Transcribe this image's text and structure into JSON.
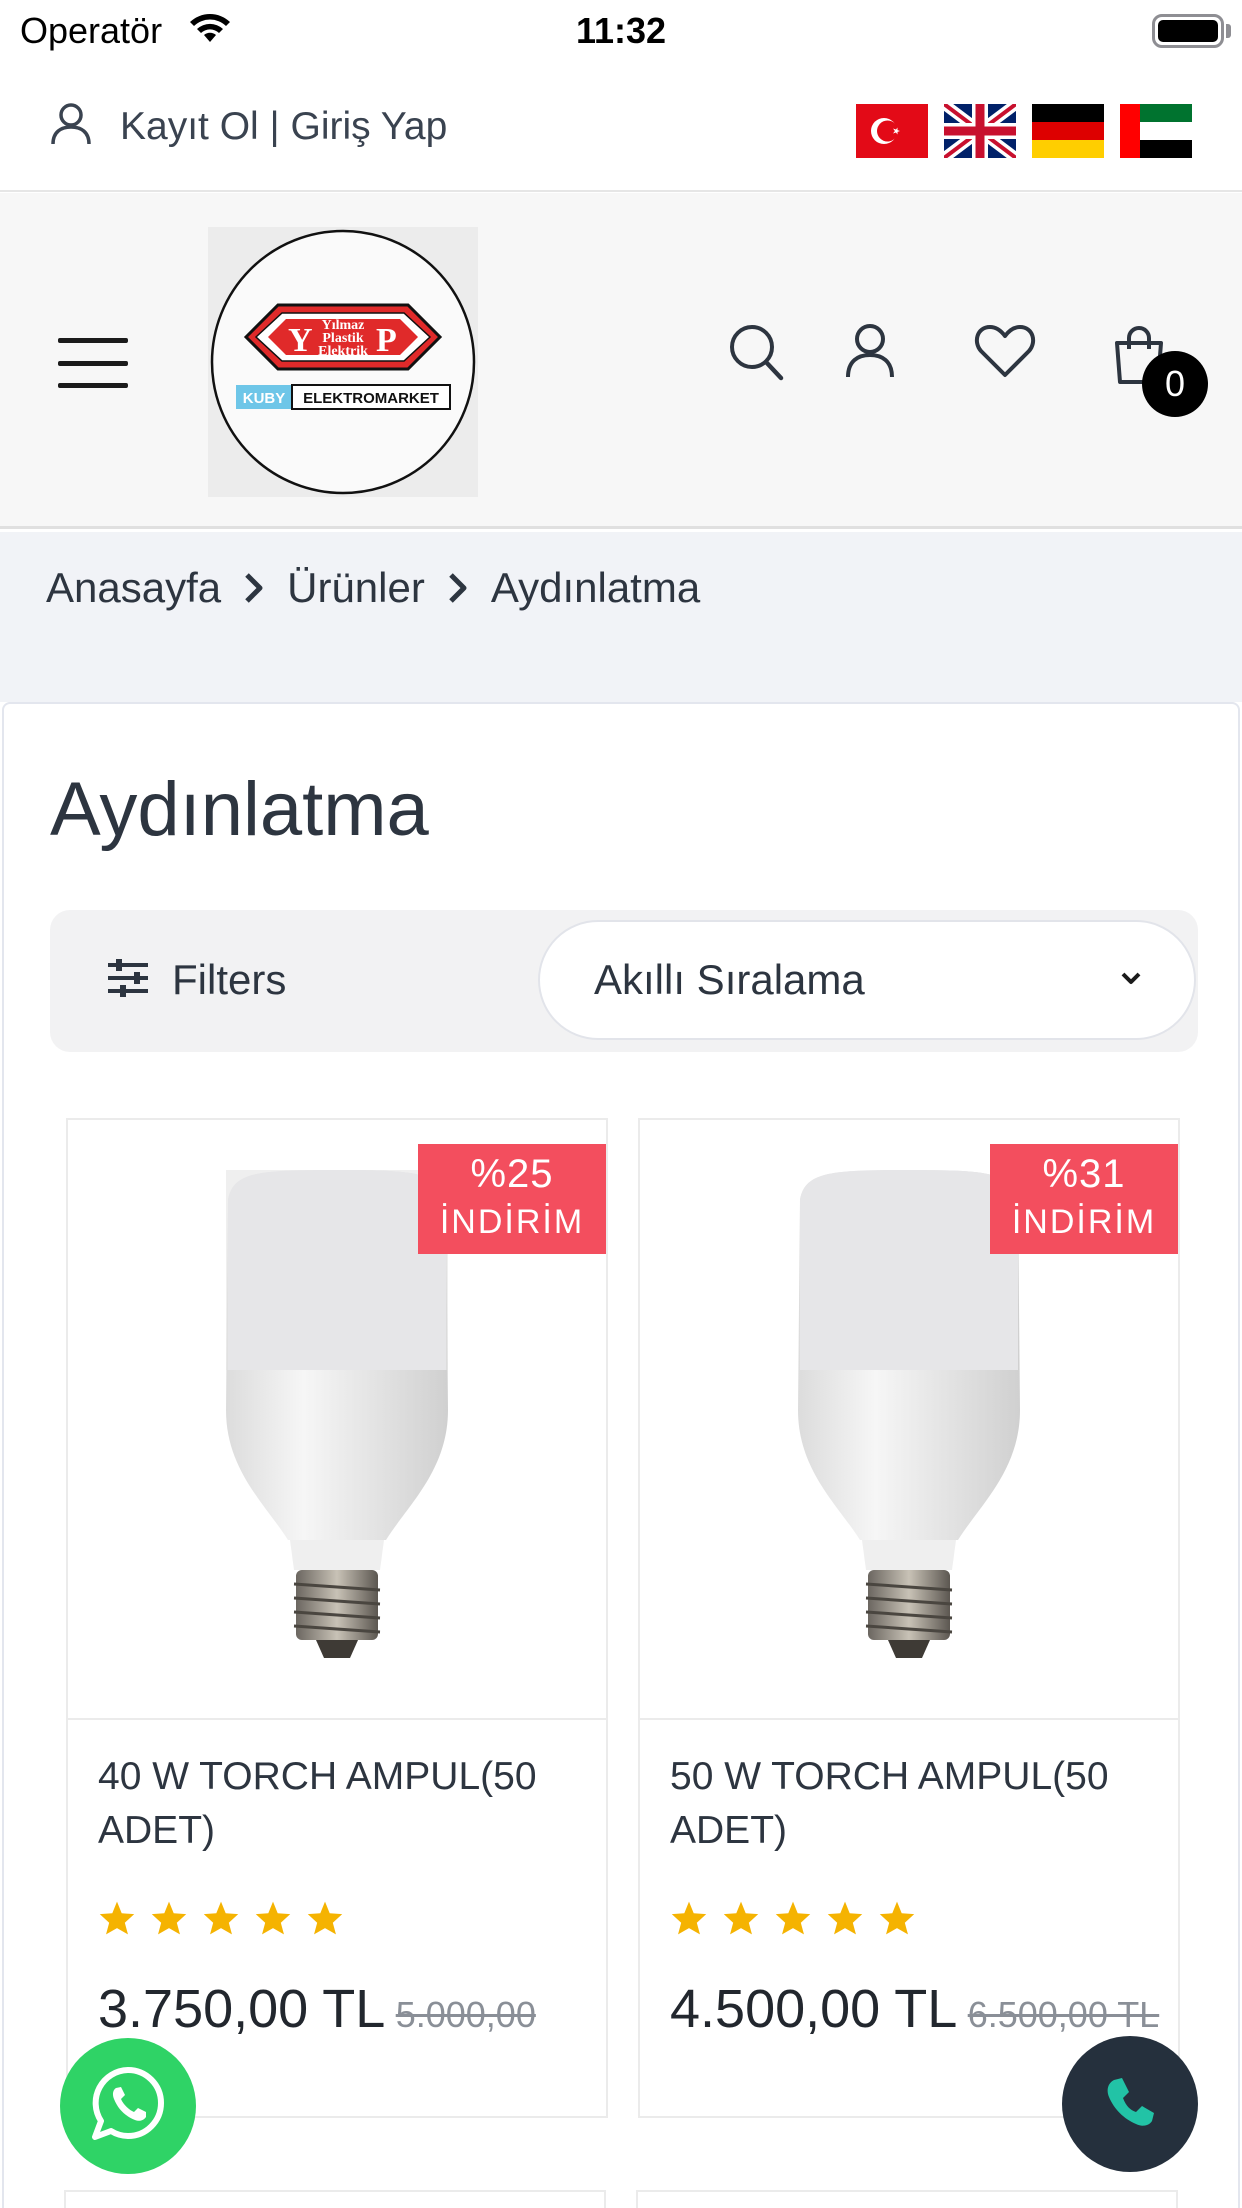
{
  "status_bar": {
    "carrier": "Operatör",
    "time": "11:32"
  },
  "top_links": {
    "auth_text": "Kayıt Ol | Giriş Yap",
    "flags": [
      "turkey-flag",
      "uk-flag",
      "germany-flag",
      "uae-flag"
    ]
  },
  "header": {
    "logo": {
      "name_line1": "Yılmaz",
      "name_line2": "Plastik",
      "name_line3": "Elektrik",
      "letter_left": "Y",
      "letter_right": "P",
      "brand_left": "KUBY",
      "brand_right": "ELEKTROMARKET"
    },
    "cart_count": "0"
  },
  "breadcrumb": [
    "Anasayfa",
    "Ürünler",
    "Aydınlatma"
  ],
  "page": {
    "title": "Aydınlatma",
    "filters_label": "Filters",
    "sort_selected": "Akıllı Sıralama"
  },
  "products": [
    {
      "name": "40 W TORCH AMPUL(50 ADET)",
      "discount_pct": "%25",
      "discount_text": "İNDİRİM",
      "rating": 5,
      "price": "3.750,00 TL",
      "old_price": "5.000,00"
    },
    {
      "name": "50 W TORCH AMPUL(50 ADET)",
      "discount_pct": "%31",
      "discount_text": "İNDİRİM",
      "rating": 5,
      "price": "4.500,00 TL",
      "old_price": "6.500,00 TL"
    }
  ],
  "colors": {
    "badge": "#f34e5e",
    "star": "#f5b301",
    "whatsapp": "#2fd366",
    "call": "#25303d",
    "call_icon": "#22c3a6"
  }
}
